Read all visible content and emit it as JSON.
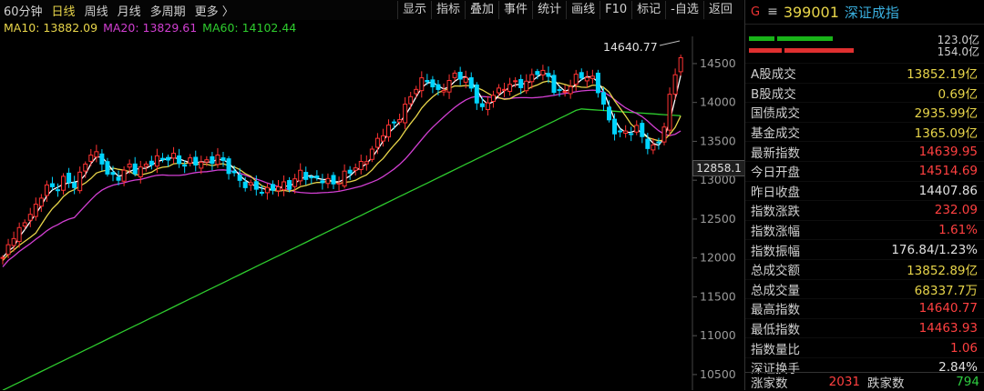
{
  "period_tabs": [
    "60分钟",
    "日线",
    "周线",
    "月线",
    "多周期",
    "更多 〉"
  ],
  "active_period": 1,
  "toolbar": [
    "显示",
    "指标",
    "叠加",
    "事件",
    "统计",
    "画线",
    "F10",
    "标记",
    "-自选",
    "返回"
  ],
  "ma_legend": {
    "ma10": "MA10: 13882.09",
    "ma20": "MA20: 13829.61",
    "ma60": "MA60: 14102.44"
  },
  "colors": {
    "up": "#ff3333",
    "down": "#00d4ff",
    "ma5": "#ffffff",
    "ma10": "#e8d54a",
    "ma20": "#d23fd2",
    "ma60": "#2ecc2e"
  },
  "cursor_value": "12858.1",
  "high_label": "14640.77",
  "price_axis": {
    "ticks": [
      "14500",
      "14000",
      "13500",
      "13000",
      "12500",
      "12000",
      "11500",
      "11000",
      "10500"
    ],
    "range": [
      10300,
      14850
    ]
  },
  "index": {
    "badge": "G",
    "menu_icon": "≡",
    "code": "399001",
    "name": "深证成指"
  },
  "flow": [
    {
      "value": "123.0亿",
      "color": "#19b319",
      "fill": 0.54
    },
    {
      "value": "154.0亿",
      "color": "#e03030",
      "fill": 0.68
    }
  ],
  "stats": [
    {
      "label": "A股成交",
      "value": "13852.19亿",
      "tone": "yellow"
    },
    {
      "label": "B股成交",
      "value": "0.69亿",
      "tone": "yellow"
    },
    {
      "label": "国债成交",
      "value": "2935.99亿",
      "tone": "yellow"
    },
    {
      "label": "基金成交",
      "value": "1365.09亿",
      "tone": "yellow"
    },
    {
      "label": "最新指数",
      "value": "14639.95",
      "tone": "red"
    },
    {
      "label": "今日开盘",
      "value": "14514.69",
      "tone": "red"
    },
    {
      "label": "昨日收盘",
      "value": "14407.86",
      "tone": "white"
    },
    {
      "label": "指数涨跌",
      "value": "232.09",
      "tone": "red"
    },
    {
      "label": "指数涨幅",
      "value": "1.61%",
      "tone": "red"
    },
    {
      "label": "指数振幅",
      "value": "176.84/1.23%",
      "tone": "white"
    },
    {
      "label": "总成交额",
      "value": "13852.89亿",
      "tone": "yellow"
    },
    {
      "label": "总成交量",
      "value": "68337.7万",
      "tone": "yellow"
    },
    {
      "label": "最高指数",
      "value": "14640.77",
      "tone": "red"
    },
    {
      "label": "最低指数",
      "value": "14463.93",
      "tone": "red"
    },
    {
      "label": "指数量比",
      "value": "1.06",
      "tone": "red"
    },
    {
      "label": "深证换手",
      "value": "2.84%",
      "tone": "white"
    }
  ],
  "breadth": {
    "up_label": "涨家数",
    "up_value": "2031",
    "down_label": "跌家数",
    "down_value": "794"
  }
}
